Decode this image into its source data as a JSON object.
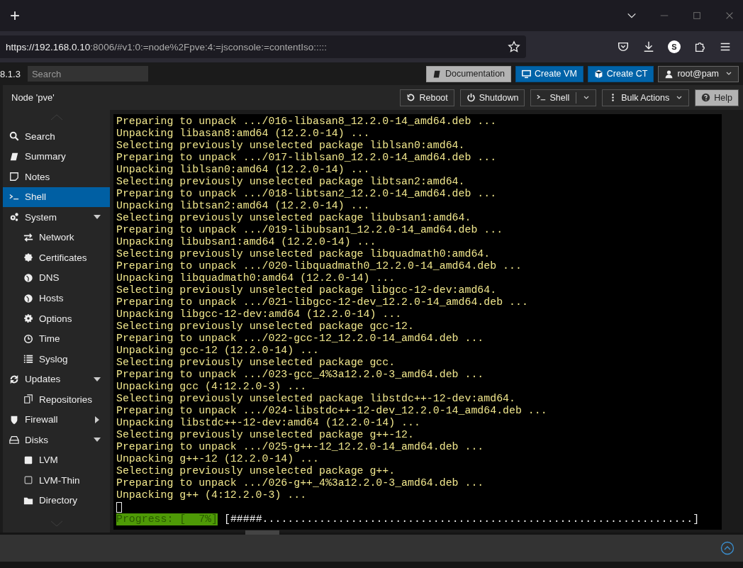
{
  "browser": {
    "new_tab": "+",
    "url_host": "https://192.168.0.10",
    "url_rest": ":8006/#v1:0:=node%2Fpve:4:=jsconsole:=contentIso:::::",
    "profile_initial": "S"
  },
  "header": {
    "version": "8.1.3",
    "search": {
      "placeholder": "Search"
    },
    "buttons": [
      {
        "label": "Documentation",
        "kind": "doc"
      },
      {
        "label": "Create VM",
        "kind": "vm"
      },
      {
        "label": "Create CT",
        "kind": "ct"
      }
    ],
    "user": "root@pam"
  },
  "panel": {
    "title": "Node 'pve'",
    "buttons": [
      {
        "label": "Reboot",
        "kind": "reboot"
      },
      {
        "label": "Shutdown",
        "kind": "power"
      },
      {
        "label": "Shell",
        "kind": "shell"
      },
      {
        "label": "Bulk Actions",
        "kind": "bulk"
      },
      {
        "label": "Help",
        "kind": "help"
      }
    ]
  },
  "sidebar": {
    "items": [
      {
        "label": "Search",
        "kind": "search",
        "selected": false
      },
      {
        "label": "Summary",
        "kind": "book",
        "selected": false
      },
      {
        "label": "Notes",
        "kind": "note",
        "selected": false
      },
      {
        "label": "Shell",
        "kind": "terminal",
        "selected": true
      },
      {
        "label": "System",
        "kind": "gears",
        "selected": false,
        "expanded": true,
        "children": [
          {
            "label": "Network",
            "kind": "arrows",
            "selected": false
          },
          {
            "label": "Certificates",
            "kind": "badge",
            "selected": false
          },
          {
            "label": "DNS",
            "kind": "globe",
            "selected": false
          },
          {
            "label": "Hosts",
            "kind": "globe",
            "selected": false
          },
          {
            "label": "Options",
            "kind": "gear",
            "selected": false
          },
          {
            "label": "Time",
            "kind": "clock",
            "selected": false
          },
          {
            "label": "Syslog",
            "kind": "list",
            "selected": false
          }
        ]
      },
      {
        "label": "Updates",
        "kind": "refresh",
        "selected": false,
        "expanded": true,
        "children": [
          {
            "label": "Repositories",
            "kind": "copy",
            "selected": false
          }
        ]
      },
      {
        "label": "Firewall",
        "kind": "shield",
        "selected": false,
        "expanded": false
      },
      {
        "label": "Disks",
        "kind": "drive",
        "selected": false,
        "expanded": true,
        "children": [
          {
            "label": "LVM",
            "kind": "square",
            "selected": false
          },
          {
            "label": "LVM-Thin",
            "kind": "square-outline",
            "selected": false
          },
          {
            "label": "Directory",
            "kind": "folder",
            "selected": false
          }
        ]
      }
    ]
  },
  "terminal": {
    "lines": [
      "Preparing to unpack .../016-libasan8_12.2.0-14_amd64.deb ...",
      "Unpacking libasan8:amd64 (12.2.0-14) ...",
      "Selecting previously unselected package liblsan0:amd64.",
      "Preparing to unpack .../017-liblsan0_12.2.0-14_amd64.deb ...",
      "Unpacking liblsan0:amd64 (12.2.0-14) ...",
      "Selecting previously unselected package libtsan2:amd64.",
      "Preparing to unpack .../018-libtsan2_12.2.0-14_amd64.deb ...",
      "Unpacking libtsan2:amd64 (12.2.0-14) ...",
      "Selecting previously unselected package libubsan1:amd64.",
      "Preparing to unpack .../019-libubsan1_12.2.0-14_amd64.deb ...",
      "Unpacking libubsan1:amd64 (12.2.0-14) ...",
      "Selecting previously unselected package libquadmath0:amd64.",
      "Preparing to unpack .../020-libquadmath0_12.2.0-14_amd64.deb ...",
      "Unpacking libquadmath0:amd64 (12.2.0-14) ...",
      "Selecting previously unselected package libgcc-12-dev:amd64.",
      "Preparing to unpack .../021-libgcc-12-dev_12.2.0-14_amd64.deb ...",
      "Unpacking libgcc-12-dev:amd64 (12.2.0-14) ...",
      "Selecting previously unselected package gcc-12.",
      "Preparing to unpack .../022-gcc-12_12.2.0-14_amd64.deb ...",
      "Unpacking gcc-12 (12.2.0-14) ...",
      "Selecting previously unselected package gcc.",
      "Preparing to unpack .../023-gcc_4%3a12.2.0-3_amd64.deb ...",
      "Unpacking gcc (4:12.2.0-3) ...",
      "Selecting previously unselected package libstdc++-12-dev:amd64.",
      "Preparing to unpack .../024-libstdc++-12-dev_12.2.0-14_amd64.deb ...",
      "Unpacking libstdc++-12-dev:amd64 (12.2.0-14) ...",
      "Selecting previously unselected package g++-12.",
      "Preparing to unpack .../025-g++-12_12.2.0-14_amd64.deb ...",
      "Unpacking g++-12 (12.2.0-14) ...",
      "Selecting previously unselected package g++.",
      "Preparing to unpack .../026-g++_4%3a12.2.0-3_amd64.deb ...",
      "Unpacking g++ (4:12.2.0-3) ..."
    ],
    "progress_label": "Progress: [  7%]",
    "progress_bar": "[#####....................................................................]"
  }
}
